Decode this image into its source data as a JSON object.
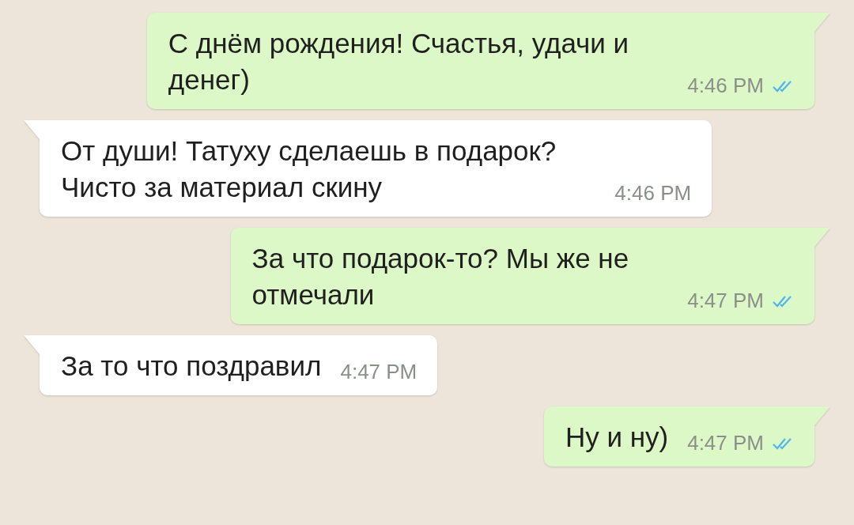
{
  "messages": [
    {
      "kind": "outgoing",
      "lines": [
        "С днём рождения! Счастья, удачи и",
        "денег)"
      ],
      "time": "4:46 PM",
      "read": true
    },
    {
      "kind": "incoming",
      "lines": [
        "От души! Татуху сделаешь в подарок?",
        "Чисто за материал скину"
      ],
      "time": "4:46 PM"
    },
    {
      "kind": "outgoing",
      "lines": [
        "За что подарок-то? Мы же не",
        "отмечали"
      ],
      "time": "4:47 PM",
      "read": true
    },
    {
      "kind": "incoming",
      "lines": [
        "За то что поздравил"
      ],
      "time": "4:47 PM"
    },
    {
      "kind": "outgoing",
      "lines": [
        "Ну и ну)"
      ],
      "time": "4:47 PM",
      "read": true
    }
  ]
}
